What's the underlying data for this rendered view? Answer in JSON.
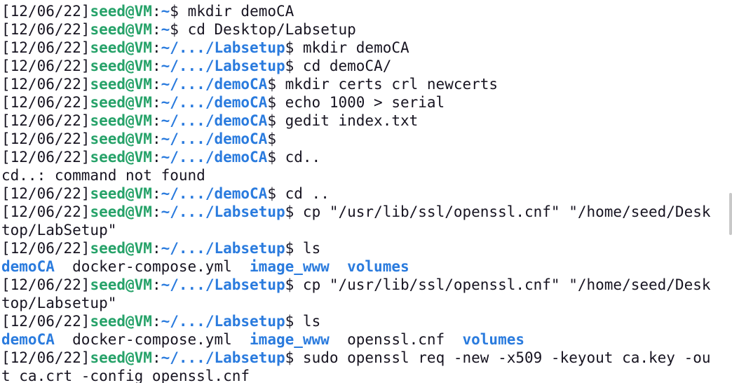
{
  "colors": {
    "background": "#ffffff",
    "text": "#171421",
    "user_host": "#26a269",
    "path": "#2a7bde",
    "directory": "#2a7bde"
  },
  "prompt": {
    "timestamp": "[12/06/22]",
    "user_host": "seed@VM",
    "separator": ":",
    "dollar": "$ "
  },
  "lines": [
    {
      "type": "cmd",
      "path": "~",
      "command": "mkdir demoCA"
    },
    {
      "type": "cmd",
      "path": "~",
      "command": "cd Desktop/Labsetup"
    },
    {
      "type": "cmd",
      "path": "~/.../Labsetup",
      "command": "mkdir demoCA"
    },
    {
      "type": "cmd",
      "path": "~/.../Labsetup",
      "command": "cd demoCA/"
    },
    {
      "type": "cmd",
      "path": "~/.../demoCA",
      "command": "mkdir certs crl newcerts"
    },
    {
      "type": "cmd",
      "path": "~/.../demoCA",
      "command": "echo 1000 > serial"
    },
    {
      "type": "cmd",
      "path": "~/.../demoCA",
      "command": "gedit index.txt"
    },
    {
      "type": "cmd",
      "path": "~/.../demoCA",
      "command": ""
    },
    {
      "type": "cmd",
      "path": "~/.../demoCA",
      "command": "cd.."
    },
    {
      "type": "out",
      "text": "cd..: command not found"
    },
    {
      "type": "cmd",
      "path": "~/.../demoCA",
      "command": "cd .."
    },
    {
      "type": "cmd",
      "path": "~/.../Labsetup",
      "command": "cp \"/usr/lib/ssl/openssl.cnf\" \"/home/seed/Desk"
    },
    {
      "type": "out",
      "text": "top/LabSetup\""
    },
    {
      "type": "cmd",
      "path": "~/.../Labsetup",
      "command": "ls"
    },
    {
      "type": "ls",
      "items": [
        {
          "name": "demoCA",
          "dir": true,
          "gap": "  "
        },
        {
          "name": "docker-compose.yml",
          "dir": false,
          "gap": "  "
        },
        {
          "name": "image_www",
          "dir": true,
          "gap": "  "
        },
        {
          "name": "volumes",
          "dir": true,
          "gap": ""
        }
      ]
    },
    {
      "type": "cmd",
      "path": "~/.../Labsetup",
      "command": "cp \"/usr/lib/ssl/openssl.cnf\" \"/home/seed/Desk"
    },
    {
      "type": "out",
      "text": "top/Labsetup\""
    },
    {
      "type": "cmd",
      "path": "~/.../Labsetup",
      "command": "ls"
    },
    {
      "type": "ls",
      "items": [
        {
          "name": "demoCA",
          "dir": true,
          "gap": "  "
        },
        {
          "name": "docker-compose.yml",
          "dir": false,
          "gap": "  "
        },
        {
          "name": "image_www",
          "dir": true,
          "gap": "  "
        },
        {
          "name": "openssl.cnf",
          "dir": false,
          "gap": "  "
        },
        {
          "name": "volumes",
          "dir": true,
          "gap": ""
        }
      ]
    },
    {
      "type": "cmd",
      "path": "~/.../Labsetup",
      "command": "sudo openssl req -new -x509 -keyout ca.key -ou"
    },
    {
      "type": "out",
      "text": "t ca.crt -config openssl.cnf"
    }
  ]
}
